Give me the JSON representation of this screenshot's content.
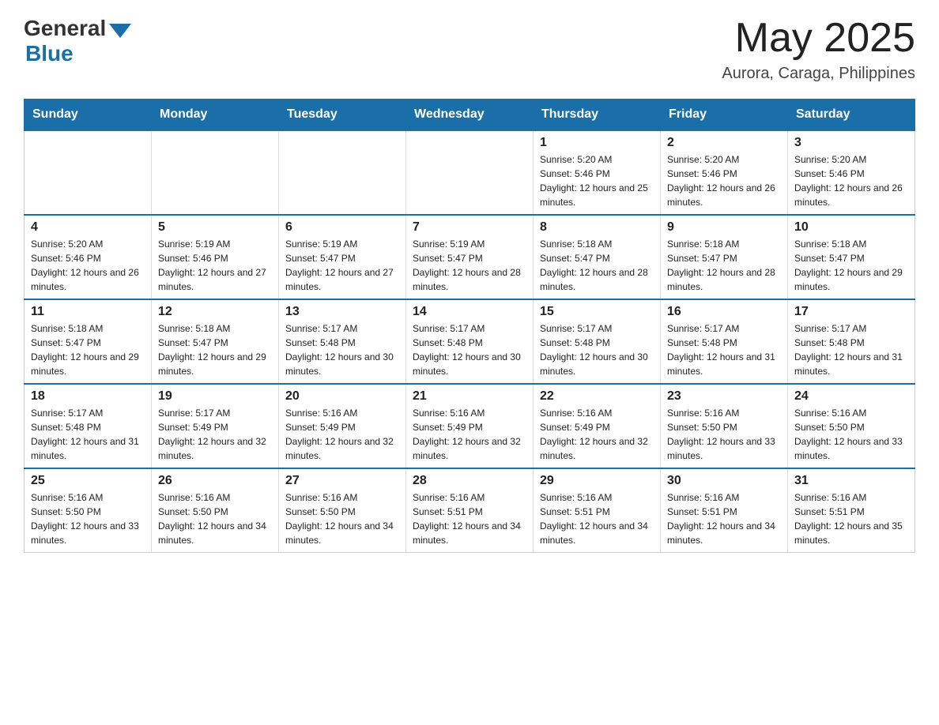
{
  "logo": {
    "general": "General",
    "blue": "Blue"
  },
  "header": {
    "month_year": "May 2025",
    "location": "Aurora, Caraga, Philippines"
  },
  "weekdays": [
    "Sunday",
    "Monday",
    "Tuesday",
    "Wednesday",
    "Thursday",
    "Friday",
    "Saturday"
  ],
  "weeks": [
    [
      {
        "day": "",
        "info": ""
      },
      {
        "day": "",
        "info": ""
      },
      {
        "day": "",
        "info": ""
      },
      {
        "day": "",
        "info": ""
      },
      {
        "day": "1",
        "info": "Sunrise: 5:20 AM\nSunset: 5:46 PM\nDaylight: 12 hours and 25 minutes."
      },
      {
        "day": "2",
        "info": "Sunrise: 5:20 AM\nSunset: 5:46 PM\nDaylight: 12 hours and 26 minutes."
      },
      {
        "day": "3",
        "info": "Sunrise: 5:20 AM\nSunset: 5:46 PM\nDaylight: 12 hours and 26 minutes."
      }
    ],
    [
      {
        "day": "4",
        "info": "Sunrise: 5:20 AM\nSunset: 5:46 PM\nDaylight: 12 hours and 26 minutes."
      },
      {
        "day": "5",
        "info": "Sunrise: 5:19 AM\nSunset: 5:46 PM\nDaylight: 12 hours and 27 minutes."
      },
      {
        "day": "6",
        "info": "Sunrise: 5:19 AM\nSunset: 5:47 PM\nDaylight: 12 hours and 27 minutes."
      },
      {
        "day": "7",
        "info": "Sunrise: 5:19 AM\nSunset: 5:47 PM\nDaylight: 12 hours and 28 minutes."
      },
      {
        "day": "8",
        "info": "Sunrise: 5:18 AM\nSunset: 5:47 PM\nDaylight: 12 hours and 28 minutes."
      },
      {
        "day": "9",
        "info": "Sunrise: 5:18 AM\nSunset: 5:47 PM\nDaylight: 12 hours and 28 minutes."
      },
      {
        "day": "10",
        "info": "Sunrise: 5:18 AM\nSunset: 5:47 PM\nDaylight: 12 hours and 29 minutes."
      }
    ],
    [
      {
        "day": "11",
        "info": "Sunrise: 5:18 AM\nSunset: 5:47 PM\nDaylight: 12 hours and 29 minutes."
      },
      {
        "day": "12",
        "info": "Sunrise: 5:18 AM\nSunset: 5:47 PM\nDaylight: 12 hours and 29 minutes."
      },
      {
        "day": "13",
        "info": "Sunrise: 5:17 AM\nSunset: 5:48 PM\nDaylight: 12 hours and 30 minutes."
      },
      {
        "day": "14",
        "info": "Sunrise: 5:17 AM\nSunset: 5:48 PM\nDaylight: 12 hours and 30 minutes."
      },
      {
        "day": "15",
        "info": "Sunrise: 5:17 AM\nSunset: 5:48 PM\nDaylight: 12 hours and 30 minutes."
      },
      {
        "day": "16",
        "info": "Sunrise: 5:17 AM\nSunset: 5:48 PM\nDaylight: 12 hours and 31 minutes."
      },
      {
        "day": "17",
        "info": "Sunrise: 5:17 AM\nSunset: 5:48 PM\nDaylight: 12 hours and 31 minutes."
      }
    ],
    [
      {
        "day": "18",
        "info": "Sunrise: 5:17 AM\nSunset: 5:48 PM\nDaylight: 12 hours and 31 minutes."
      },
      {
        "day": "19",
        "info": "Sunrise: 5:17 AM\nSunset: 5:49 PM\nDaylight: 12 hours and 32 minutes."
      },
      {
        "day": "20",
        "info": "Sunrise: 5:16 AM\nSunset: 5:49 PM\nDaylight: 12 hours and 32 minutes."
      },
      {
        "day": "21",
        "info": "Sunrise: 5:16 AM\nSunset: 5:49 PM\nDaylight: 12 hours and 32 minutes."
      },
      {
        "day": "22",
        "info": "Sunrise: 5:16 AM\nSunset: 5:49 PM\nDaylight: 12 hours and 32 minutes."
      },
      {
        "day": "23",
        "info": "Sunrise: 5:16 AM\nSunset: 5:50 PM\nDaylight: 12 hours and 33 minutes."
      },
      {
        "day": "24",
        "info": "Sunrise: 5:16 AM\nSunset: 5:50 PM\nDaylight: 12 hours and 33 minutes."
      }
    ],
    [
      {
        "day": "25",
        "info": "Sunrise: 5:16 AM\nSunset: 5:50 PM\nDaylight: 12 hours and 33 minutes."
      },
      {
        "day": "26",
        "info": "Sunrise: 5:16 AM\nSunset: 5:50 PM\nDaylight: 12 hours and 34 minutes."
      },
      {
        "day": "27",
        "info": "Sunrise: 5:16 AM\nSunset: 5:50 PM\nDaylight: 12 hours and 34 minutes."
      },
      {
        "day": "28",
        "info": "Sunrise: 5:16 AM\nSunset: 5:51 PM\nDaylight: 12 hours and 34 minutes."
      },
      {
        "day": "29",
        "info": "Sunrise: 5:16 AM\nSunset: 5:51 PM\nDaylight: 12 hours and 34 minutes."
      },
      {
        "day": "30",
        "info": "Sunrise: 5:16 AM\nSunset: 5:51 PM\nDaylight: 12 hours and 34 minutes."
      },
      {
        "day": "31",
        "info": "Sunrise: 5:16 AM\nSunset: 5:51 PM\nDaylight: 12 hours and 35 minutes."
      }
    ]
  ]
}
